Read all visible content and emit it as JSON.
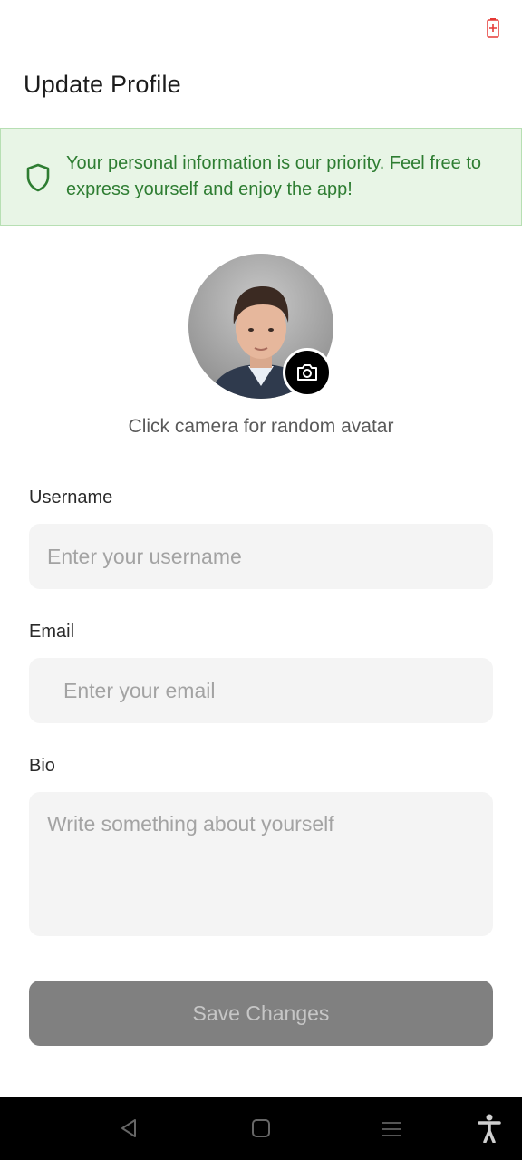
{
  "status_bar": {
    "battery_icon": "battery-charging-icon"
  },
  "header": {
    "title": "Update Profile"
  },
  "banner": {
    "icon": "shield-icon",
    "text": "Your personal information is our priority. Feel free to express yourself and enjoy the app!"
  },
  "avatar": {
    "image": "avatar-photo",
    "camera_icon": "camera-icon",
    "hint": "Click camera for random avatar"
  },
  "form": {
    "username": {
      "label": "Username",
      "value": "",
      "placeholder": "Enter your username"
    },
    "email": {
      "label": "Email",
      "value": "",
      "placeholder": "Enter your email"
    },
    "bio": {
      "label": "Bio",
      "value": "",
      "placeholder": "Write something about yourself"
    },
    "save_label": "Save Changes"
  },
  "nav_bar": {
    "icons": [
      "back-icon",
      "home-icon",
      "recents-icon",
      "accessibility-icon"
    ]
  },
  "colors": {
    "banner_bg": "#e8f5e6",
    "banner_text": "#2e7d32",
    "button_disabled": "#808080"
  }
}
